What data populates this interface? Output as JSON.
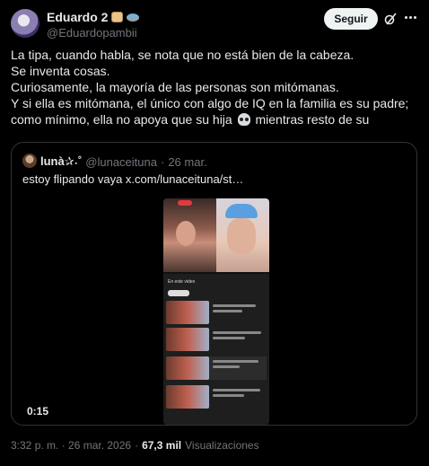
{
  "author": {
    "name": "Eduardo 2",
    "handle": "@Eduardopambii",
    "badge_icons": [
      "bread-emoji",
      "ufo-emoji"
    ]
  },
  "header_actions": {
    "follow_label": "Seguir",
    "icons": [
      "grok-icon",
      "more-icon"
    ]
  },
  "tweet": {
    "lines": [
      "La tipa, cuando habla, se nota que no está bien de la cabeza.",
      "Se inventa cosas.",
      "Curiosamente, la mayoría de las personas son mitómanas.",
      "Y si ella es mitómana, el único con algo de IQ en la familia es su padre;",
      "como mínimo, ella no apoya que su hija",
      "mientras resto de su"
    ],
    "inline_icon": "skull-emoji"
  },
  "quoted": {
    "name": "lunà✰˖˚",
    "handle": "@lunaceituna",
    "separator": "·",
    "date": "26 mar.",
    "text": "estoy flipando vaya  x.com/lunaceituna/st…",
    "video": {
      "duration": "0:15",
      "panel_title": "En este video"
    }
  },
  "meta": {
    "timestamp": "3:32 p. m. · 26 mar. 2026",
    "separator": "·",
    "views_count": "67,3 mil",
    "views_label": "Visualizaciones"
  },
  "colors": {
    "background": "#000000",
    "text_primary": "#e7e9ea",
    "text_secondary": "#71767b",
    "border": "#2f3336",
    "follow_button_bg": "#eff3f4"
  }
}
